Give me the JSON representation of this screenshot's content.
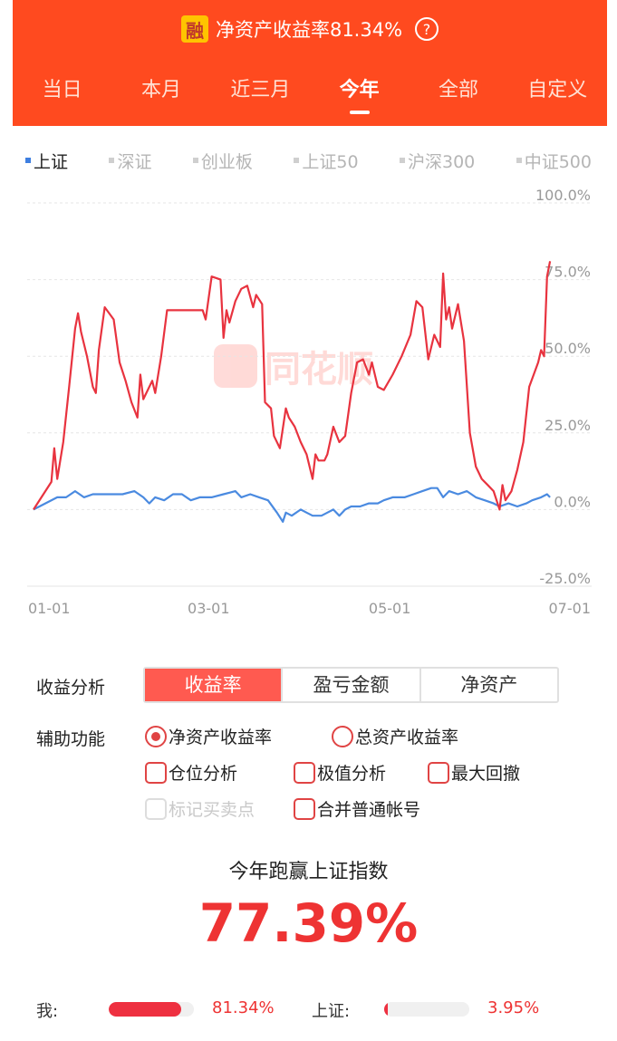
{
  "header": {
    "badge": "融",
    "title": "净资产收益率81.34%",
    "help": "?"
  },
  "tabs": [
    {
      "label": "当日",
      "active": false
    },
    {
      "label": "本月",
      "active": false
    },
    {
      "label": "近三月",
      "active": false
    },
    {
      "label": "今年",
      "active": true
    },
    {
      "label": "全部",
      "active": false
    },
    {
      "label": "自定义",
      "active": false
    }
  ],
  "indices": [
    {
      "label": "上证",
      "active": true
    },
    {
      "label": "深证",
      "active": false
    },
    {
      "label": "创业板",
      "active": false
    },
    {
      "label": "上证50",
      "active": false
    },
    {
      "label": "沪深300",
      "active": false
    },
    {
      "label": "中证500",
      "active": false
    }
  ],
  "watermark": "同花顺",
  "chart_data": {
    "type": "line",
    "y_ticks": [
      "100.0%",
      "75.0%",
      "50.0%",
      "25.0%",
      "0.0%",
      "-25.0%"
    ],
    "ylim": [
      -25,
      100
    ],
    "x_ticks": [
      {
        "label": "01-01",
        "day": 0
      },
      {
        "label": "03-01",
        "day": 59
      },
      {
        "label": "05-01",
        "day": 120
      },
      {
        "label": "07-01",
        "day": 181
      }
    ],
    "xlim": [
      0,
      181
    ],
    "colors": {
      "me": "#e8333f",
      "index": "#4a8ae0"
    },
    "series": [
      {
        "name": "我",
        "key": "me",
        "points": [
          [
            0,
            0
          ],
          [
            6,
            9
          ],
          [
            7,
            20
          ],
          [
            8,
            10
          ],
          [
            10,
            22
          ],
          [
            12,
            40
          ],
          [
            14,
            59
          ],
          [
            15,
            64
          ],
          [
            16,
            58
          ],
          [
            18,
            50
          ],
          [
            20,
            40
          ],
          [
            21,
            38
          ],
          [
            22,
            52
          ],
          [
            24,
            66
          ],
          [
            27,
            62
          ],
          [
            29,
            48
          ],
          [
            31,
            42
          ],
          [
            33,
            35
          ],
          [
            35,
            30
          ],
          [
            36,
            44
          ],
          [
            37,
            36
          ],
          [
            40,
            42
          ],
          [
            41,
            38
          ],
          [
            43,
            50
          ],
          [
            45,
            65
          ],
          [
            57,
            65
          ],
          [
            58,
            62
          ],
          [
            60,
            76
          ],
          [
            63,
            75
          ],
          [
            64,
            56
          ],
          [
            65,
            65
          ],
          [
            66,
            61
          ],
          [
            68,
            68
          ],
          [
            70,
            72
          ],
          [
            72,
            73
          ],
          [
            74,
            66
          ],
          [
            75,
            70
          ],
          [
            77,
            67
          ],
          [
            78,
            35
          ],
          [
            80,
            33
          ],
          [
            81,
            24
          ],
          [
            83,
            20
          ],
          [
            85,
            33
          ],
          [
            86,
            30
          ],
          [
            88,
            27
          ],
          [
            90,
            22
          ],
          [
            92,
            18
          ],
          [
            94,
            10
          ],
          [
            95,
            18
          ],
          [
            96,
            16
          ],
          [
            98,
            16
          ],
          [
            99,
            18
          ],
          [
            101,
            27
          ],
          [
            103,
            22
          ],
          [
            105,
            24
          ],
          [
            107,
            38
          ],
          [
            109,
            48
          ],
          [
            111,
            49
          ],
          [
            113,
            44
          ],
          [
            114,
            48
          ],
          [
            116,
            40
          ],
          [
            118,
            39
          ],
          [
            121,
            44
          ],
          [
            124,
            50
          ],
          [
            127,
            57
          ],
          [
            129,
            68
          ],
          [
            131,
            66
          ],
          [
            133,
            49
          ],
          [
            135,
            57
          ],
          [
            137,
            53
          ],
          [
            138,
            77
          ],
          [
            139,
            62
          ],
          [
            140,
            66
          ],
          [
            141,
            59
          ],
          [
            143,
            67
          ],
          [
            145,
            55
          ],
          [
            147,
            25
          ],
          [
            149,
            14
          ],
          [
            151,
            10
          ],
          [
            153,
            8
          ],
          [
            155,
            6
          ],
          [
            157,
            0
          ],
          [
            158,
            8
          ],
          [
            159,
            3
          ],
          [
            161,
            6
          ],
          [
            163,
            13
          ],
          [
            165,
            22
          ],
          [
            167,
            40
          ],
          [
            170,
            48
          ],
          [
            171,
            52
          ],
          [
            172,
            50
          ],
          [
            173,
            76
          ],
          [
            174,
            81
          ]
        ]
      },
      {
        "name": "上证",
        "key": "index",
        "points": [
          [
            0,
            0
          ],
          [
            4,
            2
          ],
          [
            8,
            4
          ],
          [
            11,
            4
          ],
          [
            14,
            6
          ],
          [
            17,
            4
          ],
          [
            20,
            5
          ],
          [
            23,
            5
          ],
          [
            27,
            5
          ],
          [
            30,
            5
          ],
          [
            34,
            6
          ],
          [
            37,
            4
          ],
          [
            39,
            2
          ],
          [
            41,
            4
          ],
          [
            44,
            3
          ],
          [
            47,
            5
          ],
          [
            50,
            5
          ],
          [
            53,
            3
          ],
          [
            56,
            4
          ],
          [
            60,
            4
          ],
          [
            64,
            5
          ],
          [
            68,
            6
          ],
          [
            70,
            4
          ],
          [
            73,
            5
          ],
          [
            76,
            4
          ],
          [
            79,
            3
          ],
          [
            82,
            -1
          ],
          [
            84,
            -4
          ],
          [
            85,
            -1
          ],
          [
            87,
            -2
          ],
          [
            90,
            0
          ],
          [
            92,
            -1
          ],
          [
            94,
            -2
          ],
          [
            97,
            -2
          ],
          [
            99,
            -1
          ],
          [
            101,
            0
          ],
          [
            103,
            -2
          ],
          [
            105,
            0
          ],
          [
            107,
            1
          ],
          [
            110,
            1
          ],
          [
            113,
            2
          ],
          [
            116,
            2
          ],
          [
            118,
            3
          ],
          [
            121,
            4
          ],
          [
            125,
            4
          ],
          [
            128,
            5
          ],
          [
            131,
            6
          ],
          [
            134,
            7
          ],
          [
            136,
            7
          ],
          [
            138,
            4
          ],
          [
            140,
            6
          ],
          [
            143,
            5
          ],
          [
            146,
            6
          ],
          [
            149,
            4
          ],
          [
            152,
            3
          ],
          [
            155,
            2
          ],
          [
            157,
            1
          ],
          [
            160,
            2
          ],
          [
            163,
            1
          ],
          [
            166,
            2
          ],
          [
            168,
            3
          ],
          [
            171,
            4
          ],
          [
            173,
            5
          ],
          [
            174,
            4
          ]
        ]
      }
    ]
  },
  "analysis": {
    "label": "收益分析",
    "options": [
      {
        "label": "收益率",
        "active": true
      },
      {
        "label": "盈亏金额",
        "active": false
      },
      {
        "label": "净资产",
        "active": false
      }
    ]
  },
  "aux": {
    "label": "辅助功能",
    "radio_net": "净资产收益率",
    "radio_total": "总资产收益率",
    "check_position": "仓位分析",
    "check_extreme": "极值分析",
    "check_drawdown": "最大回撤",
    "check_mark": "标记买卖点",
    "check_merge": "合并普通帐号"
  },
  "beat": {
    "title": "今年跑赢上证指数",
    "value": "77.39%"
  },
  "compare": {
    "me_label": "我:",
    "me_value": "81.34%",
    "me_fill": 0.85,
    "index_label": "上证:",
    "index_value": "3.95%",
    "index_fill": 0.04
  }
}
